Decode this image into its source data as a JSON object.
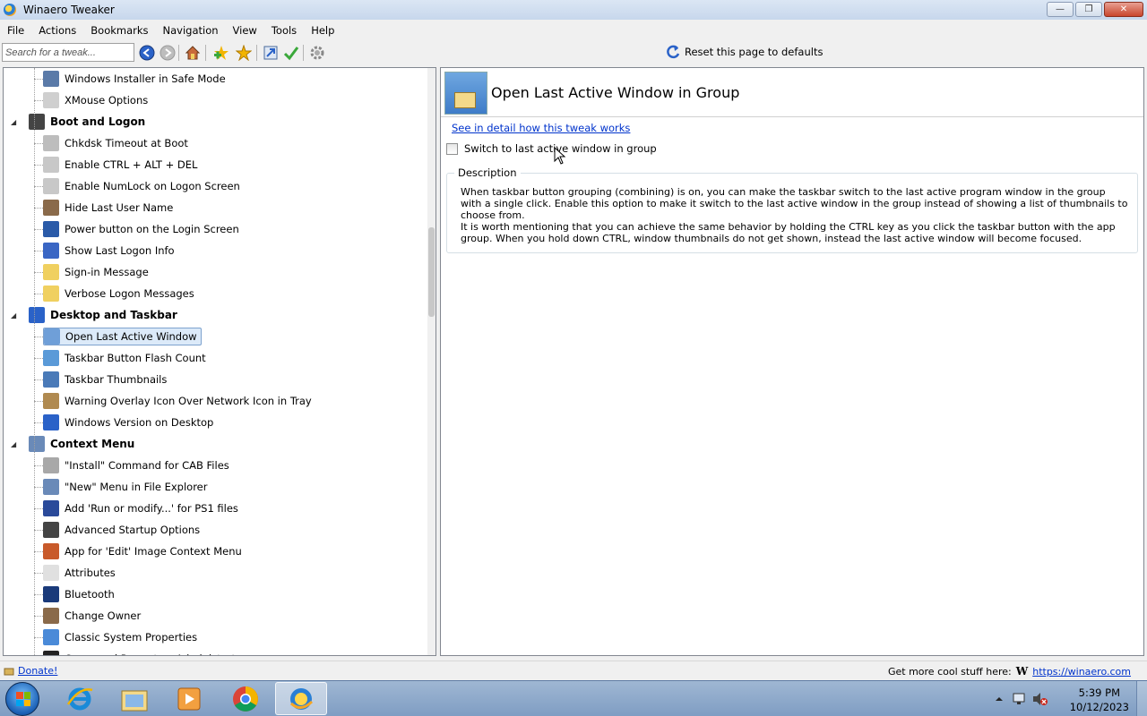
{
  "window": {
    "title": "Winaero Tweaker",
    "minimize": "—",
    "restore": "❐",
    "close": "✕"
  },
  "menu": [
    "File",
    "Actions",
    "Bookmarks",
    "Navigation",
    "View",
    "Tools",
    "Help"
  ],
  "toolbar": {
    "search_placeholder": "Search for a tweak...",
    "reset_label": "Reset this page to defaults"
  },
  "tree": {
    "rows": [
      {
        "kind": "leaf",
        "label": "Windows Installer in Safe Mode",
        "icon": "installer-icon",
        "color": "#5a7aa8"
      },
      {
        "kind": "leaf",
        "label": "XMouse Options",
        "icon": "mouse-icon",
        "color": "#cfcfcf"
      },
      {
        "kind": "cat",
        "label": "Boot and Logon",
        "icon": "spinner-icon",
        "color": "#444444"
      },
      {
        "kind": "leaf",
        "label": "Chkdsk Timeout at Boot",
        "icon": "disk-icon",
        "color": "#bdbdbd"
      },
      {
        "kind": "leaf",
        "label": "Enable CTRL + ALT + DEL",
        "icon": "keyboard-icon",
        "color": "#c8c8c8"
      },
      {
        "kind": "leaf",
        "label": "Enable NumLock on Logon Screen",
        "icon": "keyboard-icon",
        "color": "#c8c8c8"
      },
      {
        "kind": "leaf",
        "label": "Hide Last User Name",
        "icon": "user-icon",
        "color": "#8a6a4a"
      },
      {
        "kind": "leaf",
        "label": "Power button on the Login Screen",
        "icon": "power-icon",
        "color": "#2a5aa8"
      },
      {
        "kind": "leaf",
        "label": "Show Last Logon Info",
        "icon": "shield-icon",
        "color": "#3a66c4"
      },
      {
        "kind": "leaf",
        "label": "Sign-in Message",
        "icon": "message-icon",
        "color": "#f0d060"
      },
      {
        "kind": "leaf",
        "label": "Verbose Logon Messages",
        "icon": "message-icon",
        "color": "#f0d060"
      },
      {
        "kind": "cat",
        "label": "Desktop and Taskbar",
        "icon": "desktop-icon",
        "color": "#2a62c8"
      },
      {
        "kind": "leaf",
        "label": "Open Last Active Window",
        "icon": "window-icon",
        "color": "#6f9fd8",
        "selected": true
      },
      {
        "kind": "leaf",
        "label": "Taskbar Button Flash Count",
        "icon": "taskbar-icon",
        "color": "#5a9ad8"
      },
      {
        "kind": "leaf",
        "label": "Taskbar Thumbnails",
        "icon": "thumbnail-icon",
        "color": "#4a7ab8"
      },
      {
        "kind": "leaf",
        "label": "Warning Overlay Icon Over Network Icon in Tray",
        "icon": "warning-icon",
        "color": "#b08a50"
      },
      {
        "kind": "leaf",
        "label": "Windows Version on Desktop",
        "icon": "desktop-icon",
        "color": "#2a62c8"
      },
      {
        "kind": "cat",
        "label": "Context Menu",
        "icon": "context-menu-icon",
        "color": "#6a8ab8"
      },
      {
        "kind": "leaf",
        "label": "\"Install\" Command for CAB Files",
        "icon": "cab-icon",
        "color": "#a8a8a8"
      },
      {
        "kind": "leaf",
        "label": "\"New\" Menu in File Explorer",
        "icon": "new-menu-icon",
        "color": "#6a8ab8"
      },
      {
        "kind": "leaf",
        "label": "Add 'Run or modify...' for PS1 files",
        "icon": "powershell-icon",
        "color": "#2a4a9a"
      },
      {
        "kind": "leaf",
        "label": "Advanced Startup Options",
        "icon": "spinner-icon",
        "color": "#444444"
      },
      {
        "kind": "leaf",
        "label": "App for 'Edit' Image Context Menu",
        "icon": "paint-icon",
        "color": "#c85a2a"
      },
      {
        "kind": "leaf",
        "label": "Attributes",
        "icon": "attributes-icon",
        "color": "#e0e0e0"
      },
      {
        "kind": "leaf",
        "label": "Bluetooth",
        "icon": "bluetooth-icon",
        "color": "#1a3a7a"
      },
      {
        "kind": "leaf",
        "label": "Change Owner",
        "icon": "user-icon",
        "color": "#8a6a4a"
      },
      {
        "kind": "leaf",
        "label": "Classic System Properties",
        "icon": "computer-icon",
        "color": "#4a8ad8"
      },
      {
        "kind": "leaf",
        "label": "Command Prompt as Administrator",
        "icon": "cmd-icon",
        "color": "#222222"
      }
    ]
  },
  "content": {
    "title": "Open Last Active Window in Group",
    "detail_link": "See in detail how this tweak works",
    "checkbox_label": "Switch to last active window in group",
    "checkbox_checked": false,
    "description_legend": "Description",
    "description_p1": "When taskbar button grouping (combining) is on, you can make the taskbar switch to the last active program window in the group with a single click. Enable this option to make it switch to the last active window in the group instead of showing a list of thumbnails to choose from.",
    "description_p2": "It is worth mentioning that you can achieve the same behavior by holding the CTRL key as you click the taskbar button with the app group. When you hold down CTRL, window thumbnails do not get shown, instead the last active window will become focused."
  },
  "status": {
    "donate": "Donate!",
    "more_text": "Get more cool stuff here:",
    "logo": "W",
    "link": "https://winaero.com"
  },
  "taskbar": {
    "time": "5:39 PM",
    "date": "10/12/2023"
  }
}
